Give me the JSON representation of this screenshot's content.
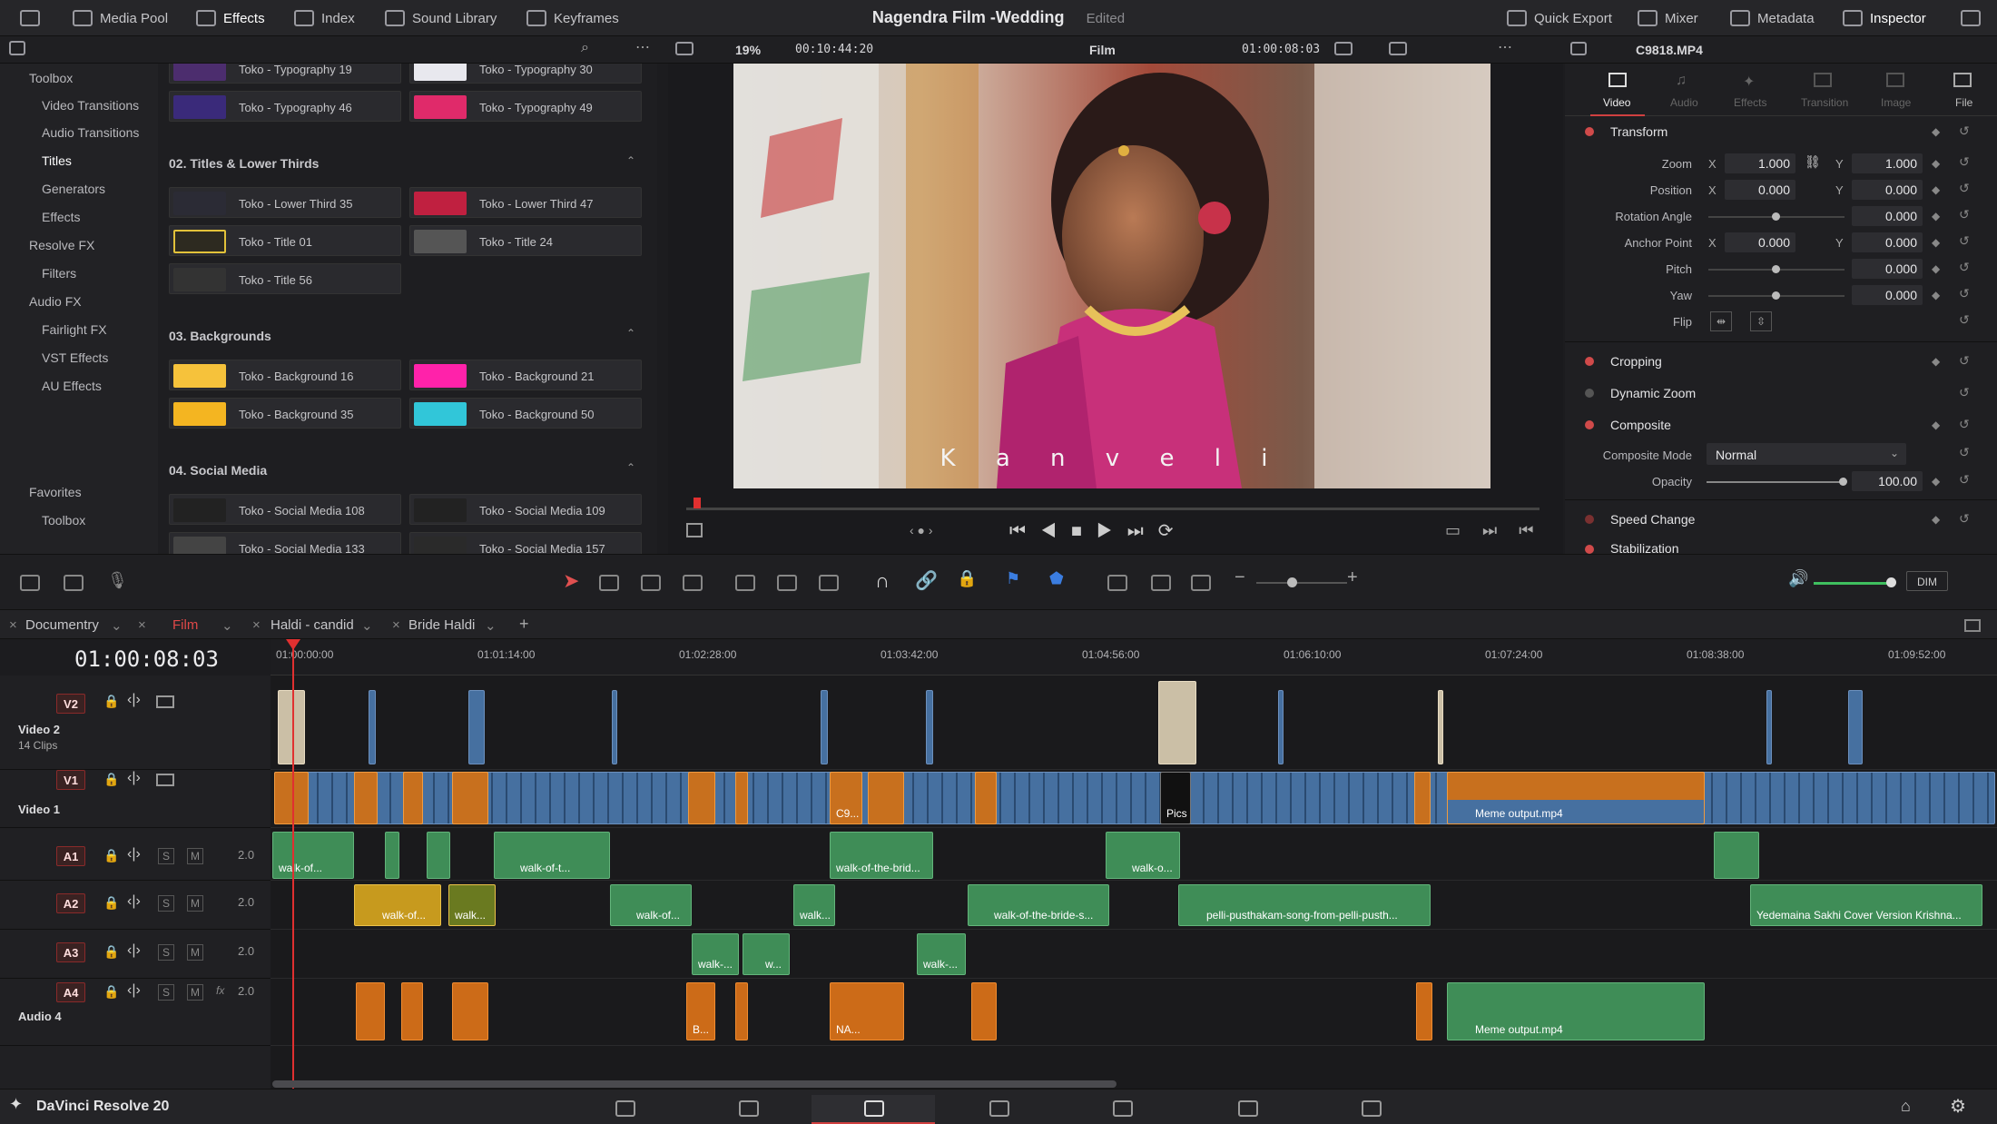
{
  "header": {
    "title": "Nagendra Film -Wedding",
    "status": "Edited",
    "left_buttons": [
      "Media Pool",
      "Effects",
      "Index",
      "Sound Library",
      "Keyframes"
    ],
    "right_buttons": [
      "Quick Export",
      "Mixer",
      "Metadata",
      "Inspector"
    ]
  },
  "viewer_bar": {
    "zoom": "19%",
    "source_timecode": "00:10:44:20",
    "timeline_name": "Film",
    "record_timecode": "01:00:08:03",
    "clip_name": "C9818.MP4"
  },
  "toolbox": {
    "items": [
      "Toolbox",
      "Video Transitions",
      "Audio Transitions",
      "Titles",
      "Generators",
      "Effects",
      "Resolve FX",
      "Filters",
      "Audio FX",
      "Fairlight FX",
      "VST Effects",
      "AU Effects"
    ],
    "favorites": [
      "Favorites",
      "Toolbox"
    ]
  },
  "effects": {
    "top_row": [
      "Toko - Typography 19",
      "Toko - Typography 30",
      "Toko - Typography 46",
      "Toko - Typography 49"
    ],
    "sections": [
      {
        "title": "02. Titles & Lower Thirds",
        "items": [
          "Toko - Lower Third 35",
          "Toko - Lower Third 47",
          "Toko - Title 01",
          "Toko - Title 24",
          "Toko - Title 56"
        ]
      },
      {
        "title": "03. Backgrounds",
        "items": [
          "Toko - Background 16",
          "Toko - Background 21",
          "Toko - Background 35",
          "Toko - Background 50"
        ]
      },
      {
        "title": "04. Social Media",
        "items": [
          "Toko - Social Media 108",
          "Toko - Social Media 109",
          "Toko - Social Media 133",
          "Toko - Social Media 157"
        ]
      }
    ],
    "thumb_colors": [
      "#4c2d6e",
      "#e8e8ee",
      "#3a2a7a",
      "#e02a6a",
      "#f6c23b",
      "#ff22aa",
      "#f4b521",
      "#31c6d9"
    ]
  },
  "viewer": {
    "caption": "K a n v e l i"
  },
  "inspector": {
    "tabs": [
      "Video",
      "Audio",
      "Effects",
      "Transition",
      "Image",
      "File"
    ],
    "transform": {
      "title": "Transform",
      "zoom_label": "Zoom",
      "zoom_x": "1.000",
      "zoom_y": "1.000",
      "position_label": "Position",
      "position_x": "0.000",
      "position_y": "0.000",
      "rotation_label": "Rotation Angle",
      "rotation": "0.000",
      "anchor_label": "Anchor Point",
      "anchor_x": "0.000",
      "anchor_y": "0.000",
      "pitch_label": "Pitch",
      "pitch": "0.000",
      "yaw_label": "Yaw",
      "yaw": "0.000",
      "flip_label": "Flip",
      "x_label": "X",
      "y_label": "Y"
    },
    "sections": [
      "Cropping",
      "Dynamic Zoom",
      "Composite",
      "Speed Change",
      "Stabilization"
    ],
    "composite": {
      "mode_label": "Composite Mode",
      "mode": "Normal",
      "opacity_label": "Opacity",
      "opacity": "100.00"
    }
  },
  "timeline": {
    "tabs": [
      "Documentry",
      "Film",
      "Haldi - candid",
      "Bride Haldi"
    ],
    "timecode": "01:00:08:03",
    "ruler": [
      "01:00:00:00",
      "01:01:14:00",
      "01:02:28:00",
      "01:03:42:00",
      "01:04:56:00",
      "01:06:10:00",
      "01:07:24:00",
      "01:08:38:00",
      "01:09:52:00"
    ],
    "dim_label": "DIM",
    "tracks": [
      {
        "id": "V2",
        "name": "Video 2",
        "sub": "14 Clips"
      },
      {
        "id": "V1",
        "name": "Video 1",
        "sub": ""
      },
      {
        "id": "A1",
        "name": "",
        "sub": "",
        "level": "2.0"
      },
      {
        "id": "A2",
        "name": "",
        "sub": "",
        "level": "2.0"
      },
      {
        "id": "A3",
        "name": "",
        "sub": "",
        "level": "2.0"
      },
      {
        "id": "A4",
        "name": "Audio 4",
        "sub": "",
        "level": "2.0"
      }
    ],
    "clips": {
      "v1_pics": "Pics",
      "v1_c9": "C9...",
      "v1_meme": "Meme output.mp4",
      "a1": [
        "walk-of...",
        "walk-of-t...",
        "walk-of-the-brid...",
        "walk-o..."
      ],
      "a2": [
        "walk-of...",
        "walk...",
        "walk-of...",
        "walk...",
        "walk-of-the-bride-s...",
        "pelli-pusthakam-song-from-pelli-pusth...",
        "Yedemaina Sakhi  Cover Version  Krishna..."
      ],
      "a3": [
        "walk-...",
        "w...",
        "walk-..."
      ],
      "a4": [
        "B...",
        "NA...",
        "Meme output.mp4"
      ]
    }
  },
  "footer": {
    "brand": "DaVinci Resolve 20"
  }
}
